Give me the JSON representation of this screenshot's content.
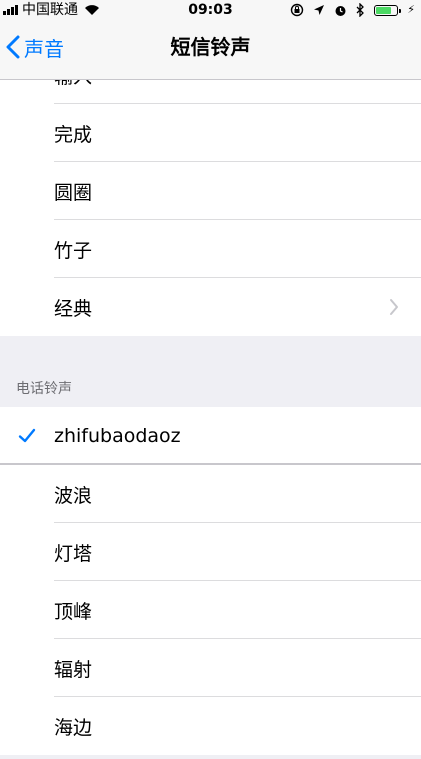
{
  "status_bar": {
    "carrier": "中国联通",
    "time": "09:03",
    "icons": [
      "signal-icon",
      "wifi-icon",
      "screen-lock-icon",
      "location-icon",
      "alarm-icon",
      "bluetooth-icon",
      "battery-icon",
      "charging-icon"
    ],
    "battery_level": 0.75,
    "battery_color": "#4cd964"
  },
  "nav": {
    "back_label": "声音",
    "title": "短信铃声",
    "accent_color": "#007aff"
  },
  "text_tones": {
    "partial_item": "输入",
    "items": [
      {
        "label": "完成"
      },
      {
        "label": "圆圈"
      },
      {
        "label": "竹子"
      },
      {
        "label": "经典",
        "disclosure": true
      }
    ]
  },
  "ringtones": {
    "header": "电话铃声",
    "selected": {
      "label": "zhifubaodaoz",
      "checked": true
    },
    "items": [
      {
        "label": "波浪"
      },
      {
        "label": "灯塔"
      },
      {
        "label": "顶峰"
      },
      {
        "label": "辐射"
      },
      {
        "label": "海边"
      }
    ]
  }
}
